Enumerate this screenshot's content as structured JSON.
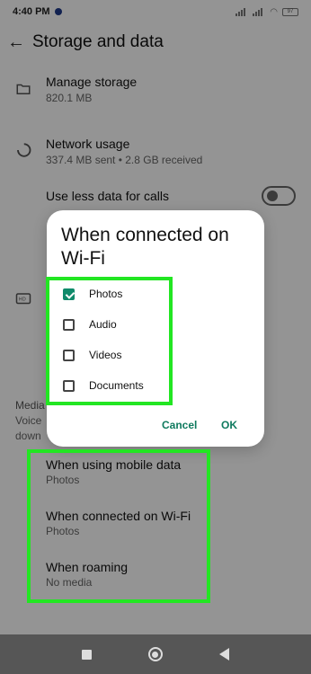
{
  "status_bar": {
    "time": "4:40 PM",
    "battery": "97"
  },
  "app_bar": {
    "title": "Storage and data"
  },
  "manage_storage": {
    "title": "Manage storage",
    "subtitle": "820.1 MB"
  },
  "network_usage": {
    "title": "Network usage",
    "subtitle": "337.4 MB sent • 2.8 GB received"
  },
  "less_data": {
    "title": "Use less data for calls",
    "enabled": false
  },
  "media_section": {
    "label": "Media",
    "partial_1": "Voice",
    "partial_2": "down"
  },
  "auto_download": [
    {
      "title": "When using mobile data",
      "value": "Photos"
    },
    {
      "title": "When connected on Wi-Fi",
      "value": "Photos"
    },
    {
      "title": "When roaming",
      "value": "No media"
    }
  ],
  "dialog": {
    "title": "When connected on Wi-Fi",
    "options": [
      {
        "label": "Photos",
        "checked": true
      },
      {
        "label": "Audio",
        "checked": false
      },
      {
        "label": "Videos",
        "checked": false
      },
      {
        "label": "Documents",
        "checked": false
      }
    ],
    "cancel_label": "Cancel",
    "ok_label": "OK"
  },
  "colors": {
    "accent": "#0f8a6a",
    "highlight": "#22e622"
  }
}
